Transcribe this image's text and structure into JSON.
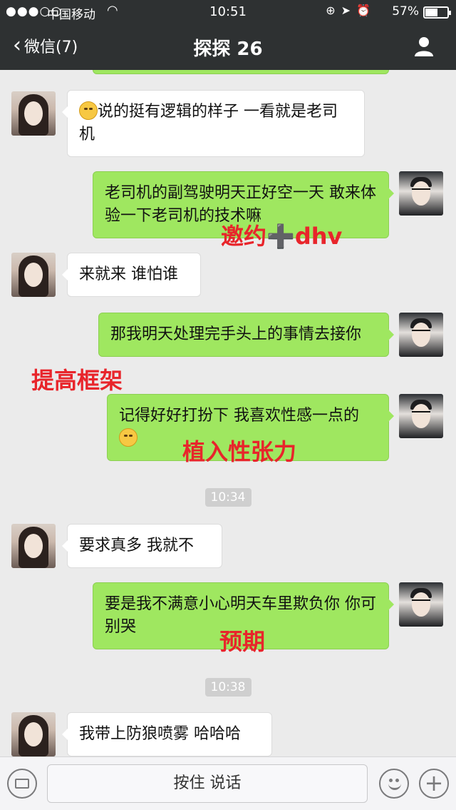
{
  "status_bar": {
    "signal": "●●●○○",
    "carrier": "中国移动",
    "time": "10:51",
    "battery_text": "57%",
    "battery_level": 0.57
  },
  "nav": {
    "back_label": "微信(7)",
    "title": "探探 26"
  },
  "messages": [
    {
      "side": "left",
      "text": "说的挺有逻辑的样子 一看就是老司机",
      "emoji_prefix": true
    },
    {
      "side": "right",
      "text": "老司机的副驾驶明天正好空一天 敢来体验一下老司机的技术嘛"
    },
    {
      "side": "left",
      "text": "来就来 谁怕谁"
    },
    {
      "side": "right",
      "text": "那我明天处理完手头上的事情去接你"
    },
    {
      "side": "right",
      "text": "记得好好打扮下 我喜欢性感一点的",
      "emoji_suffix": true
    },
    {
      "side": "left",
      "text": "要求真多 我就不"
    },
    {
      "side": "right",
      "text": "要是我不满意小心明天车里欺负你 你可别哭"
    },
    {
      "side": "left",
      "text": "我带上防狼喷雾 哈哈哈"
    }
  ],
  "timestamps": [
    "10:34",
    "10:38"
  ],
  "annotations": {
    "a1": "邀约➕dhv",
    "a2": "提高框架",
    "a3": "植入性张力",
    "a4": "预期"
  },
  "input_bar": {
    "hold_to_talk": "按住 说话"
  },
  "colors": {
    "topbar": "#2e3132",
    "bubble_right": "#9fe760",
    "bubble_left": "#ffffff",
    "annotation": "#e8252b"
  }
}
